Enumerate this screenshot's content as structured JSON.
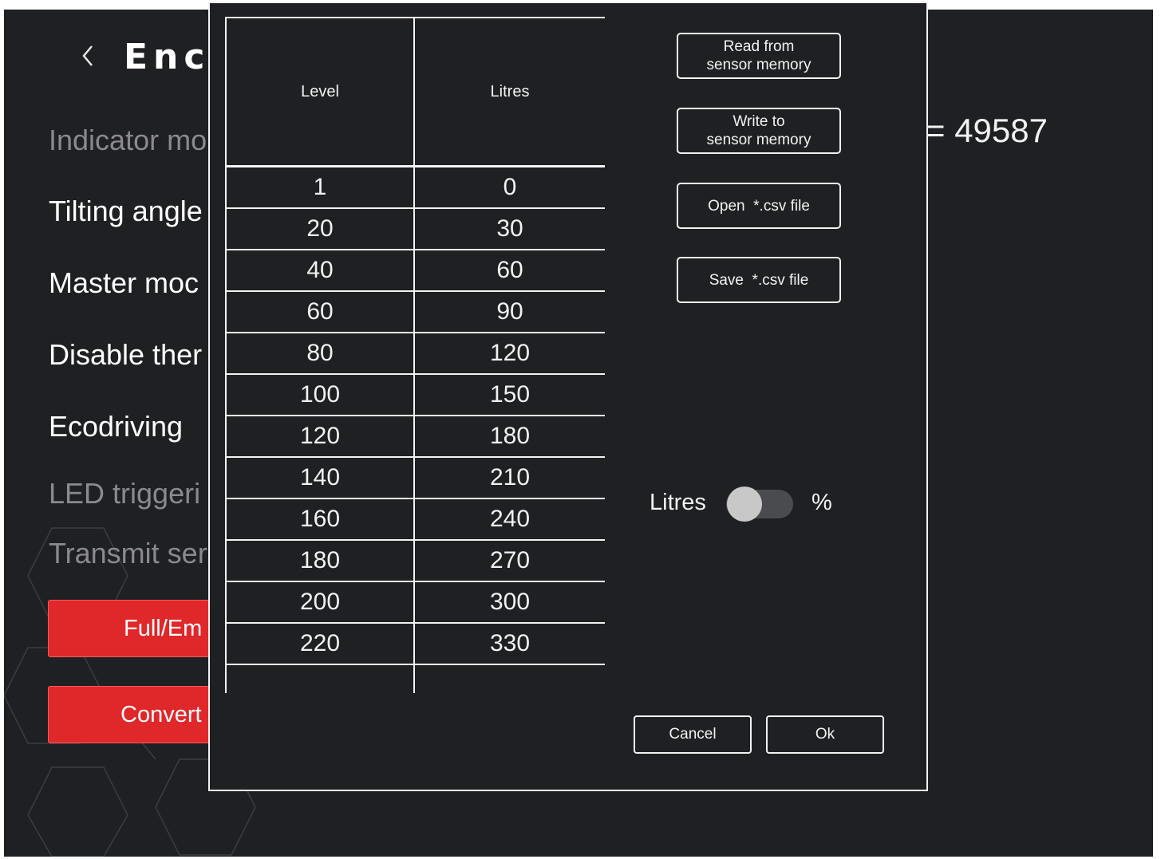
{
  "background": {
    "app_title": "Enc",
    "settings": [
      {
        "label": "Indicator mo",
        "dim": true
      },
      {
        "label": "Tilting angle",
        "dim": false
      },
      {
        "label": "Master moc",
        "dim": false
      },
      {
        "label": "Disable ther",
        "dim": false
      },
      {
        "label": "Ecodriving",
        "dim": false
      },
      {
        "label": "LED triggeri",
        "dim": true
      },
      {
        "label": "Transmit ser",
        "dim": true
      }
    ],
    "full_empty_button": "Full/Em",
    "convert_button": "Convert",
    "value_readout": "= 49587"
  },
  "dialog": {
    "columns": [
      "Level",
      "Litres"
    ],
    "rows": [
      [
        "1",
        "0"
      ],
      [
        "20",
        "30"
      ],
      [
        "40",
        "60"
      ],
      [
        "60",
        "90"
      ],
      [
        "80",
        "120"
      ],
      [
        "100",
        "150"
      ],
      [
        "120",
        "180"
      ],
      [
        "140",
        "210"
      ],
      [
        "160",
        "240"
      ],
      [
        "180",
        "270"
      ],
      [
        "200",
        "300"
      ],
      [
        "220",
        "330"
      ]
    ],
    "buttons": {
      "read_line1": "Read from",
      "read_line2": "sensor memory",
      "write_line1": "Write to",
      "write_line2": "sensor memory",
      "open_csv": "Open  *.csv file",
      "save_csv": "Save  *.csv file",
      "cancel": "Cancel",
      "ok": "Ok"
    },
    "unit_toggle": {
      "left_label": "Litres",
      "right_label": "%",
      "state": "Litres"
    }
  },
  "colors": {
    "background": "#1f2023",
    "accent_red": "#e0272a",
    "foreground": "#f2f2f2",
    "dim_text": "#8a8a8e"
  }
}
